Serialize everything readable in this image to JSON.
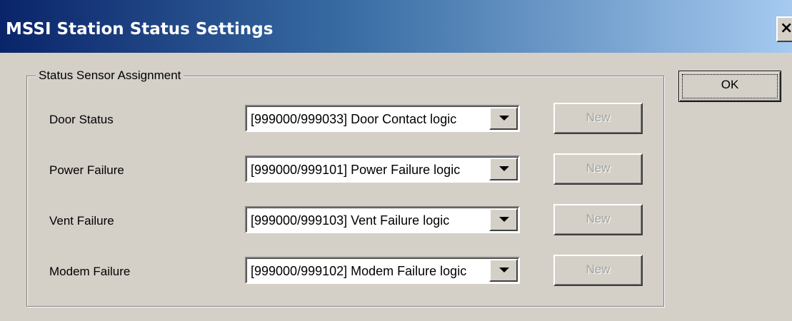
{
  "window": {
    "title": "MSSI Station Status Settings",
    "close_glyph": "×"
  },
  "group": {
    "legend": "Status Sensor Assignment"
  },
  "rows": [
    {
      "label": "Door Status",
      "selected": "[999000/999033] Door Contact logic",
      "new_label": "New"
    },
    {
      "label": "Power Failure",
      "selected": "[999000/999101] Power Failure logic",
      "new_label": "New"
    },
    {
      "label": "Vent Failure",
      "selected": "[999000/999103] Vent Failure logic",
      "new_label": "New"
    },
    {
      "label": "Modem Failure",
      "selected": "[999000/999102] Modem Failure logic",
      "new_label": "New"
    }
  ],
  "buttons": {
    "ok_label": "OK"
  },
  "colors": {
    "title_gradient_start": "#0a246a",
    "title_gradient_end": "#a6caf0",
    "face": "#d4d0c8",
    "disabled_text": "#a0a0a0"
  },
  "icons": {
    "close": "close-icon",
    "dropdown": "chevron-down-icon"
  }
}
